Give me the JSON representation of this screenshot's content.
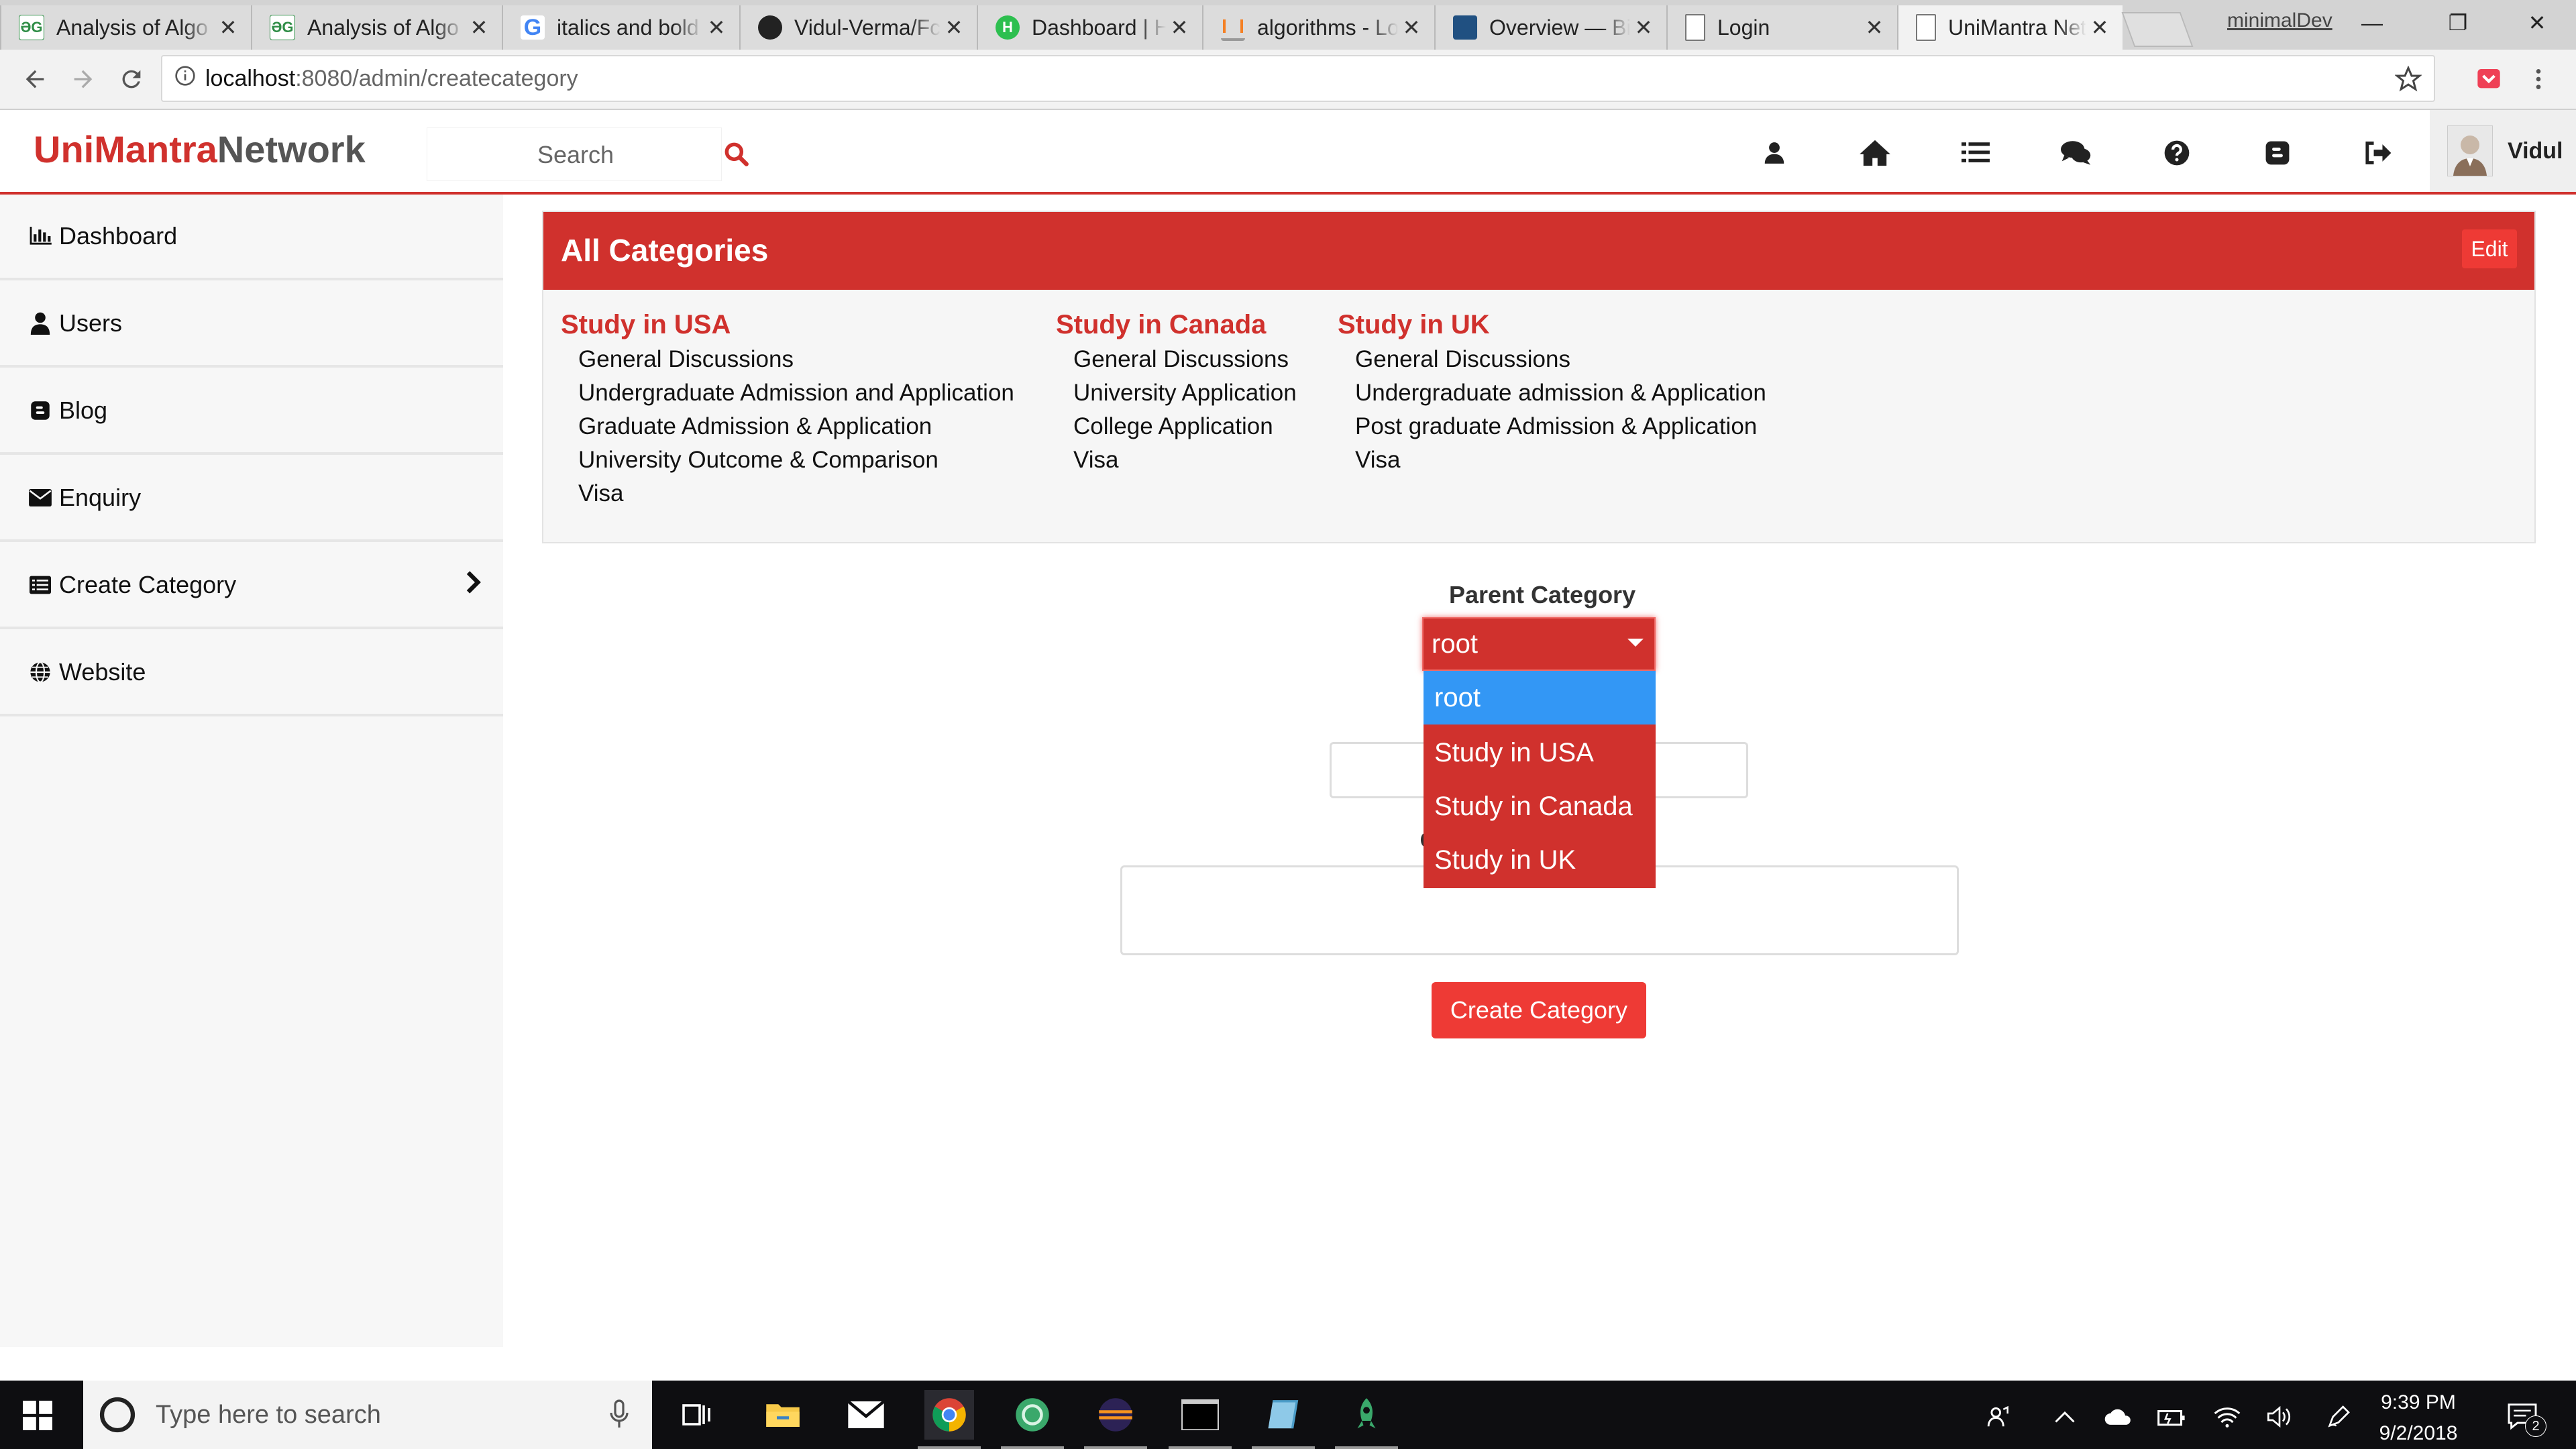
{
  "browser": {
    "tabs": [
      {
        "title": "Analysis of Algo",
        "favicon": "gfg-icon"
      },
      {
        "title": "Analysis of Algo",
        "favicon": "gfg-icon"
      },
      {
        "title": "italics and bold",
        "favicon": "google-icon"
      },
      {
        "title": "Vidul-Verma/Fc",
        "favicon": "github-icon"
      },
      {
        "title": "Dashboard | Ha",
        "favicon": "hackerearth-icon"
      },
      {
        "title": "algorithms - Lo",
        "favicon": "stackoverflow-icon"
      },
      {
        "title": "Overview — Bi",
        "favicon": "bitbucket-icon"
      },
      {
        "title": "Login",
        "favicon": "page-icon"
      },
      {
        "title": "UniMantra Net",
        "favicon": "page-icon",
        "active": true
      }
    ],
    "tab_close_glyph": "✕",
    "profile_name": "minimalDev",
    "url_host": "localhost",
    "url_path": ":8080/admin/createcategory"
  },
  "header": {
    "brand_part1": "UniMantra",
    "brand_part2": "Network",
    "search_placeholder": "Search",
    "user_name": "Vidul"
  },
  "sidebar": {
    "items": [
      {
        "label": "Dashboard",
        "icon": "bar-chart-icon"
      },
      {
        "label": "Users",
        "icon": "user-icon"
      },
      {
        "label": "Blog",
        "icon": "blogger-icon"
      },
      {
        "label": "Enquiry",
        "icon": "envelope-icon"
      },
      {
        "label": "Create Category",
        "icon": "list-alt-icon"
      },
      {
        "label": "Website",
        "icon": "globe-icon"
      }
    ]
  },
  "categories": {
    "title": "All Categories",
    "edit_label": "Edit",
    "columns": [
      {
        "title": "Study in USA",
        "items": [
          "General Discussions",
          "Undergraduate Admission and Application",
          "Graduate Admission & Application",
          "University Outcome & Comparison",
          "Visa"
        ]
      },
      {
        "title": "Study in Canada",
        "items": [
          "General Discussions",
          "University Application",
          "College Application",
          "Visa"
        ]
      },
      {
        "title": "Study in UK",
        "items": [
          "General Discussions",
          "Undergraduate admission & Application",
          "Post graduate Admission & Application",
          "Visa"
        ]
      }
    ]
  },
  "form": {
    "parent_label": "Parent Category",
    "parent_value": "root",
    "options": [
      "root",
      "Study in USA",
      "Study in Canada",
      "Study in UK"
    ],
    "submit_label": "Create Category"
  },
  "taskbar": {
    "search_placeholder": "Type here to search",
    "time": "9:39 PM",
    "date": "9/2/2018",
    "notification_count": "2"
  },
  "colors": {
    "brand_red": "#d0312d",
    "button_red": "#ee3a35",
    "selected_blue": "#3397f5"
  }
}
